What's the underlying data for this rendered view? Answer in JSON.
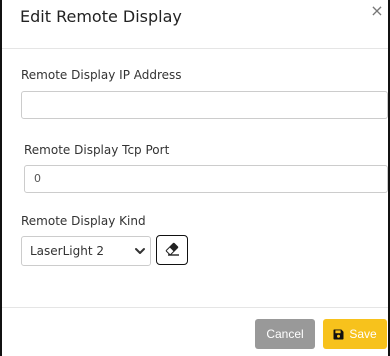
{
  "dialog": {
    "title": "Edit Remote Display",
    "close_glyph": "×"
  },
  "form": {
    "ip_label": "Remote Display IP Address",
    "ip_value": "",
    "port_label": "Remote Display Tcp Port",
    "port_value": "0",
    "kind_label": "Remote Display Kind",
    "kind_selected": "LaserLight 2"
  },
  "icons": {
    "clear": "eraser-icon",
    "save": "floppy-disk-icon",
    "close": "close-icon",
    "dropdown": "chevron-down-icon"
  },
  "footer": {
    "cancel_label": "Cancel",
    "save_label": "Save"
  },
  "colors": {
    "save_button": "#f7c21c",
    "cancel_button": "#999999"
  }
}
